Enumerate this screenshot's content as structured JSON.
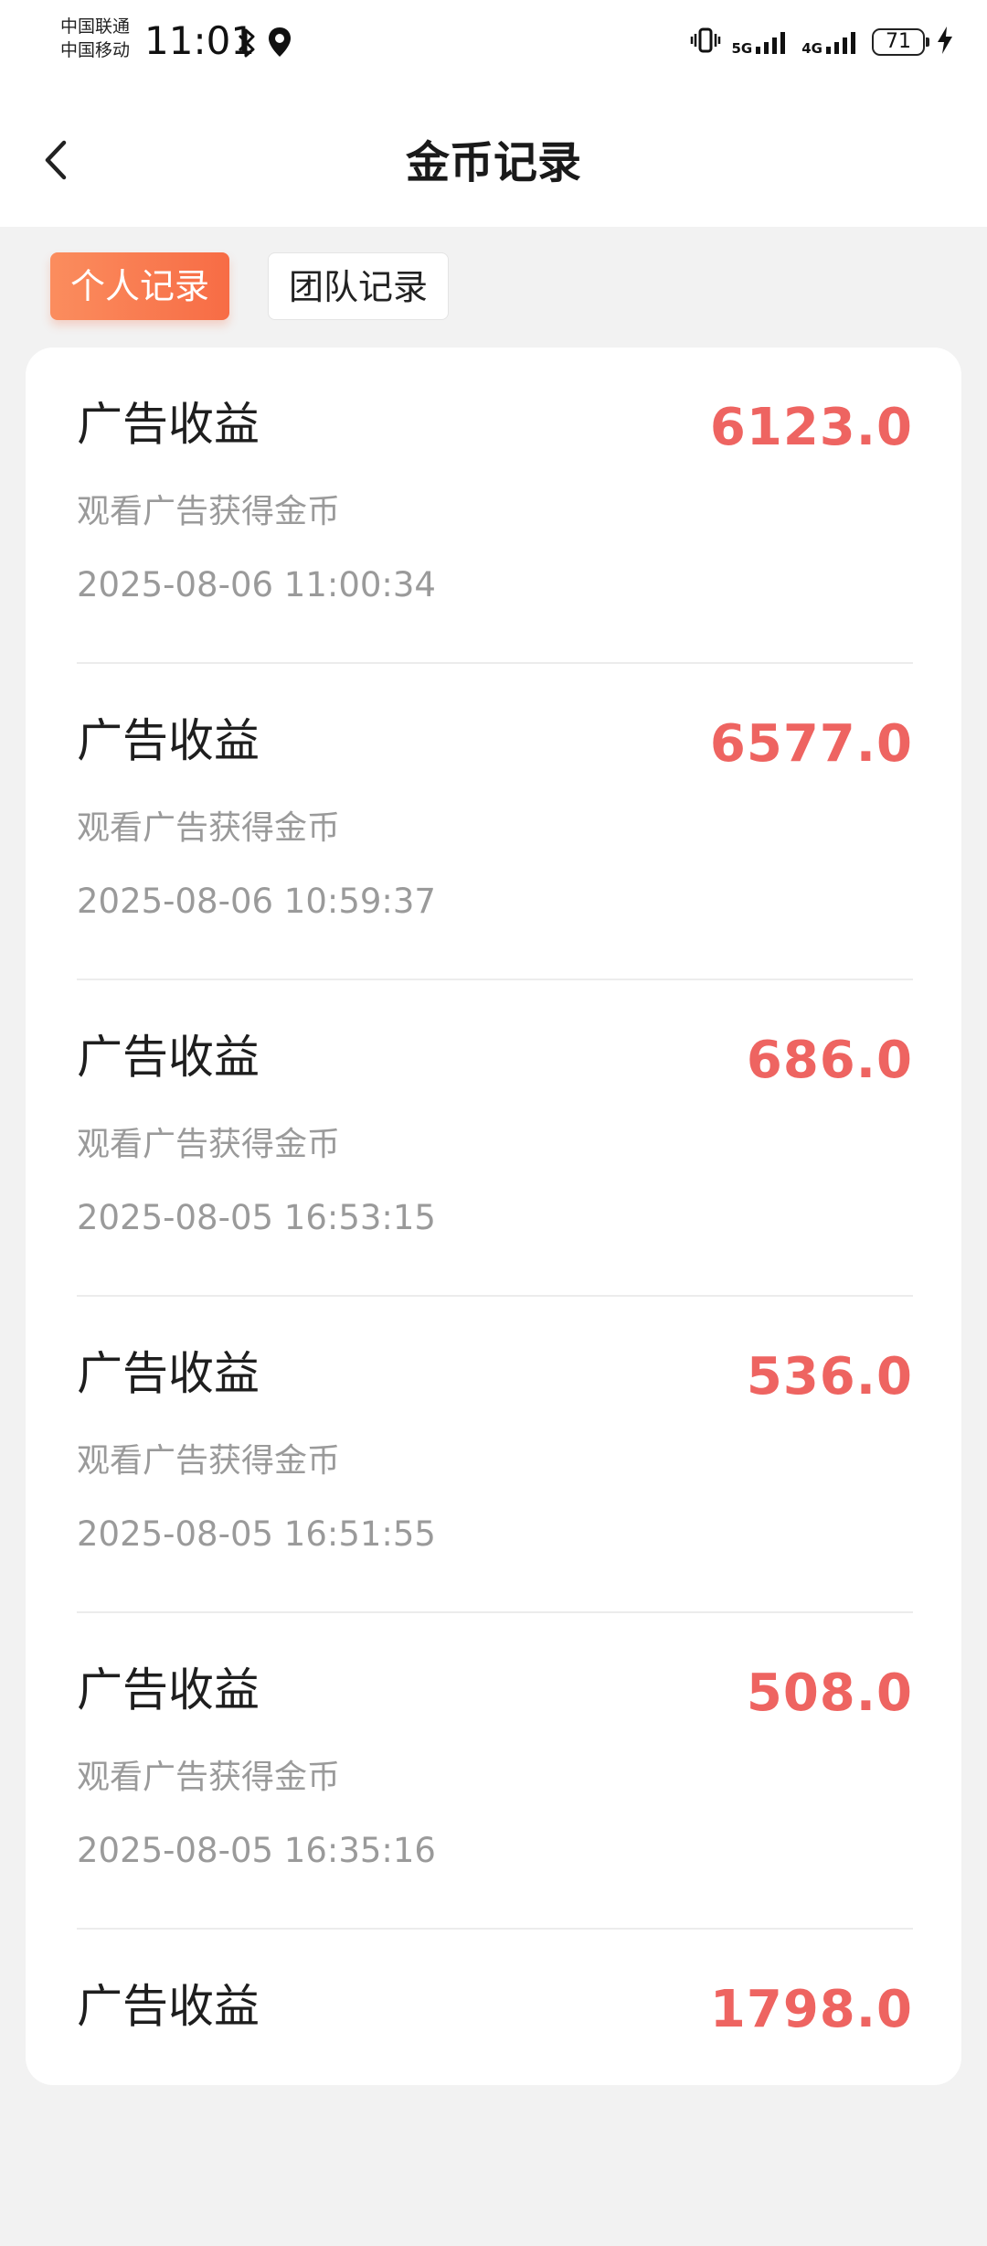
{
  "status_bar": {
    "carrier_1": "中国联通",
    "carrier_2": "中国移动",
    "time": "11:01",
    "net_1": "5G",
    "net_2": "4G",
    "battery": "71",
    "icons": [
      "bluetooth-icon",
      "location-icon",
      "vibrate-icon",
      "signal-icon",
      "battery-icon",
      "charging-icon"
    ]
  },
  "header": {
    "title": "金币记录",
    "back_icon": "chevron-left-icon"
  },
  "tabs": [
    {
      "label": "个人记录",
      "active": true
    },
    {
      "label": "团队记录",
      "active": false
    }
  ],
  "records": [
    {
      "title": "广告收益",
      "desc": "观看广告获得金币",
      "time": "2025-08-06 11:00:34",
      "amount": "6123.0"
    },
    {
      "title": "广告收益",
      "desc": "观看广告获得金币",
      "time": "2025-08-06 10:59:37",
      "amount": "6577.0"
    },
    {
      "title": "广告收益",
      "desc": "观看广告获得金币",
      "time": "2025-08-05 16:53:15",
      "amount": "686.0"
    },
    {
      "title": "广告收益",
      "desc": "观看广告获得金币",
      "time": "2025-08-05 16:51:55",
      "amount": "536.0"
    },
    {
      "title": "广告收益",
      "desc": "观看广告获得金币",
      "time": "2025-08-05 16:35:16",
      "amount": "508.0"
    },
    {
      "title": "广告收益",
      "desc": "",
      "time": "",
      "amount": "1798.0"
    }
  ],
  "colors": {
    "accent": "#f76c45",
    "amount": "#ee6461",
    "background": "#f2f2f2"
  }
}
